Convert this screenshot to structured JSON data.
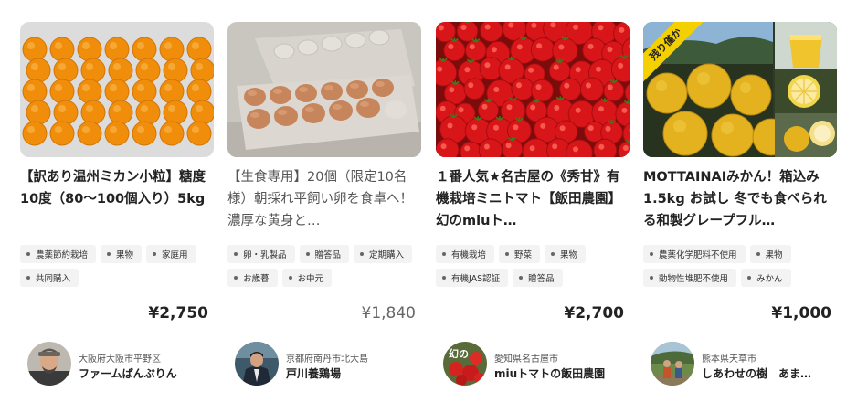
{
  "colors": {
    "tag_bg": "#f3f3f3",
    "ribbon": "#f5d000",
    "divider": "#e6e6e6"
  },
  "cards": [
    {
      "title": "【訳あり温州ミカン小粒】糖度10度（80〜100個入り）5kg",
      "tags": [
        "農薬節約栽培",
        "果物",
        "家庭用",
        "共同購入"
      ],
      "price": "¥2,750",
      "seller_location": "大阪府大阪市平野区",
      "seller_name": "ファームぱんぷりん"
    },
    {
      "title": "【生食専用】20個（限定10名様）朝採れ平飼い卵を食卓へ！ 濃厚な黄身と…",
      "tags": [
        "卵・乳製品",
        "贈答品",
        "定期購入",
        "お歳暮",
        "お中元"
      ],
      "price": "¥1,840",
      "seller_location": "京都府南丹市北大島",
      "seller_name": "戸川養鶏場"
    },
    {
      "title": "１番人気★名古屋の《秀甘》有機栽培ミニトマト【飯田農園】幻のmiuト…",
      "tags": [
        "有機栽培",
        "野菜",
        "果物",
        "有機JAS認証",
        "贈答品"
      ],
      "price": "¥2,700",
      "seller_location": "愛知県名古屋市",
      "seller_name": "miuトマトの飯田農園",
      "avatar_text": "幻の"
    },
    {
      "title": "MOTTAINAIみかん！箱込み1.5kg お試し 冬でも食べられる和製グレープフル…",
      "tags": [
        "農薬化学肥料不使用",
        "果物",
        "動物性堆肥不使用",
        "みかん"
      ],
      "price": "¥1,000",
      "seller_location": "熊本県天草市",
      "seller_name": "しあわせの樹　あま…",
      "badge": "残り僅か"
    }
  ]
}
